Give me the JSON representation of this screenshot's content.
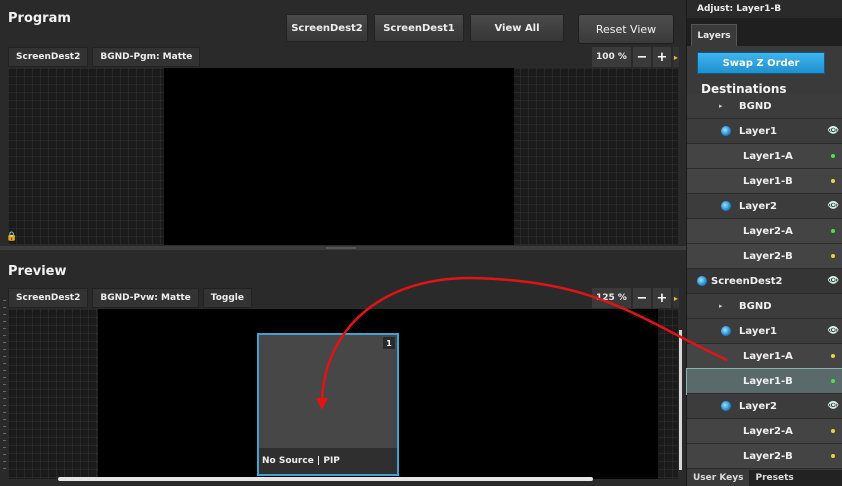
{
  "program": {
    "title": "Program",
    "tabs": [
      "ScreenDest2",
      "ScreenDest1",
      "View All"
    ],
    "reset_label": "Reset View",
    "subbar": [
      "ScreenDest2",
      "BGND-Pgm: Matte"
    ],
    "zoom": "100 %"
  },
  "preview": {
    "title": "Preview",
    "subbar": [
      "ScreenDest2",
      "BGND-Pvw: Matte",
      "Toggle"
    ],
    "zoom": "125 %",
    "pip": {
      "number": "1",
      "label": "No Source | PIP"
    }
  },
  "zoom_controls": {
    "minus": "−",
    "plus": "+"
  },
  "panel": {
    "header": "Adjust: Layer1-B",
    "tab": "Layers",
    "swap_label": "Swap Z Order",
    "destinations_title": "Destinations",
    "rows": [
      {
        "label": "BGND",
        "kind": "bgnd"
      },
      {
        "label": "Layer1",
        "kind": "layer",
        "eye": true
      },
      {
        "label": "Layer1-A",
        "kind": "sub",
        "dot": "green"
      },
      {
        "label": "Layer1-B",
        "kind": "sub",
        "dot": "yellow"
      },
      {
        "label": "Layer2",
        "kind": "layer",
        "eye": true
      },
      {
        "label": "Layer2-A",
        "kind": "sub",
        "dot": "green"
      },
      {
        "label": "Layer2-B",
        "kind": "sub",
        "dot": "yellow"
      },
      {
        "label": "ScreenDest2",
        "kind": "dest",
        "eye": true
      },
      {
        "label": "BGND",
        "kind": "bgnd"
      },
      {
        "label": "Layer1",
        "kind": "layer",
        "eye": true
      },
      {
        "label": "Layer1-A",
        "kind": "sub",
        "dot": "yellow"
      },
      {
        "label": "Layer1-B",
        "kind": "sub",
        "dot": "green",
        "selected": true
      },
      {
        "label": "Layer2",
        "kind": "layer",
        "eye": true
      },
      {
        "label": "Layer2-A",
        "kind": "sub",
        "dot": "yellow"
      },
      {
        "label": "Layer2-B",
        "kind": "sub",
        "dot": "yellow"
      }
    ],
    "bottom_tabs": [
      "User Keys",
      "Presets"
    ]
  },
  "colors": {
    "accent_blue": "#3ea3d1",
    "swap_button": "#2aa3e4",
    "arrow_red": "#e01414",
    "dot_green": "#4ee04e",
    "dot_yellow": "#f2d23a"
  }
}
